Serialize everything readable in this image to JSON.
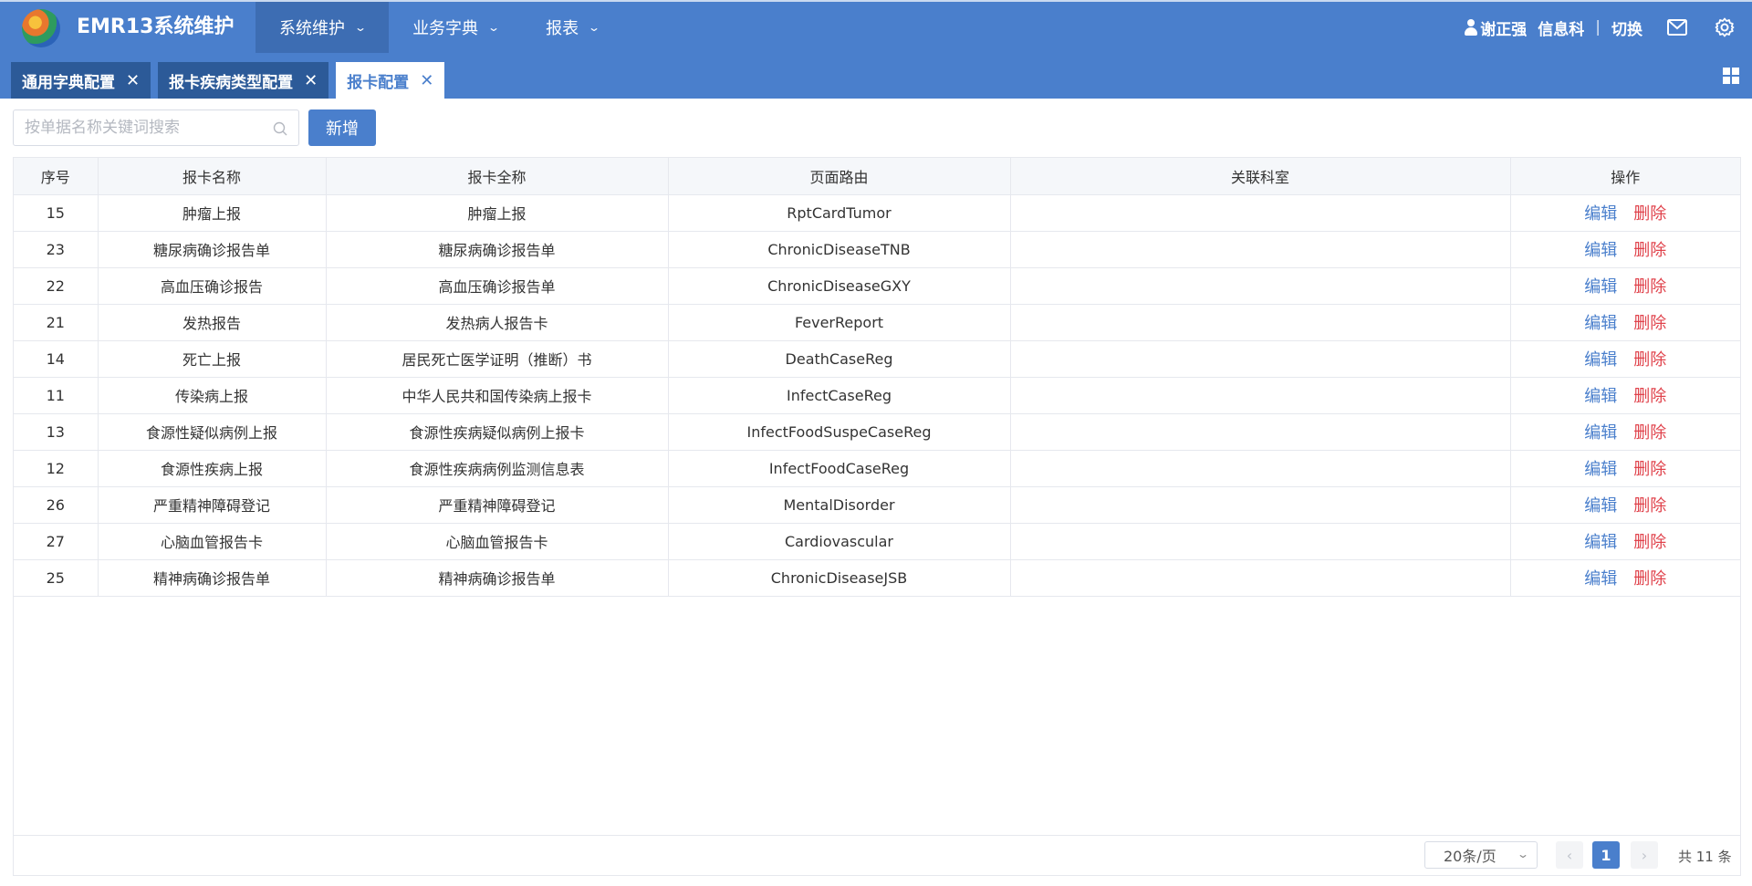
{
  "header": {
    "app_title": "EMR13系统维护",
    "nav": [
      {
        "label": "系统维护",
        "active": true
      },
      {
        "label": "业务字典",
        "active": false
      },
      {
        "label": "报表",
        "active": false
      }
    ],
    "user_name": "谢正强",
    "department": "信息科",
    "separator": "|",
    "switch_label": "切换",
    "icons": [
      "user-icon",
      "mail-icon",
      "settings-icon"
    ]
  },
  "tabs": [
    {
      "label": "通用字典配置",
      "active": false
    },
    {
      "label": "报卡疾病类型配置",
      "active": false
    },
    {
      "label": "报卡配置",
      "active": true
    }
  ],
  "toolbar": {
    "search_placeholder": "按单据名称关键词搜索",
    "search_value": "",
    "add_label": "新增"
  },
  "table": {
    "columns": [
      "序号",
      "报卡名称",
      "报卡全称",
      "页面路由",
      "关联科室",
      "操作"
    ],
    "edit_label": "编辑",
    "delete_label": "删除",
    "rows": [
      {
        "id": "15",
        "name": "肿瘤上报",
        "full_name": "肿瘤上报",
        "route": "RptCardTumor",
        "dept": ""
      },
      {
        "id": "23",
        "name": "糖尿病确诊报告单",
        "full_name": "糖尿病确诊报告单",
        "route": "ChronicDiseaseTNB",
        "dept": ""
      },
      {
        "id": "22",
        "name": "高血压确诊报告",
        "full_name": "高血压确诊报告单",
        "route": "ChronicDiseaseGXY",
        "dept": ""
      },
      {
        "id": "21",
        "name": "发热报告",
        "full_name": "发热病人报告卡",
        "route": "FeverReport",
        "dept": ""
      },
      {
        "id": "14",
        "name": "死亡上报",
        "full_name": "居民死亡医学证明（推断）书",
        "route": "DeathCaseReg",
        "dept": ""
      },
      {
        "id": "11",
        "name": "传染病上报",
        "full_name": "中华人民共和国传染病上报卡",
        "route": "InfectCaseReg",
        "dept": ""
      },
      {
        "id": "13",
        "name": "食源性疑似病例上报",
        "full_name": "食源性疾病疑似病例上报卡",
        "route": "InfectFoodSuspeCaseReg",
        "dept": ""
      },
      {
        "id": "12",
        "name": "食源性疾病上报",
        "full_name": "食源性疾病病例监测信息表",
        "route": "InfectFoodCaseReg",
        "dept": ""
      },
      {
        "id": "26",
        "name": "严重精神障碍登记",
        "full_name": "严重精神障碍登记",
        "route": "MentalDisorder",
        "dept": ""
      },
      {
        "id": "27",
        "name": "心脑血管报告卡",
        "full_name": "心脑血管报告卡",
        "route": "Cardiovascular",
        "dept": ""
      },
      {
        "id": "25",
        "name": "精神病确诊报告单",
        "full_name": "精神病确诊报告单",
        "route": "ChronicDiseaseJSB",
        "dept": ""
      }
    ]
  },
  "pager": {
    "page_size": "20条/页",
    "current_page": "1",
    "prev_label": "‹",
    "next_label": "›",
    "total": "共 11 条"
  },
  "colors": {
    "brand": "#4a7fcc",
    "tab_inactive": "#2c5a98",
    "delete": "#e0424b"
  }
}
